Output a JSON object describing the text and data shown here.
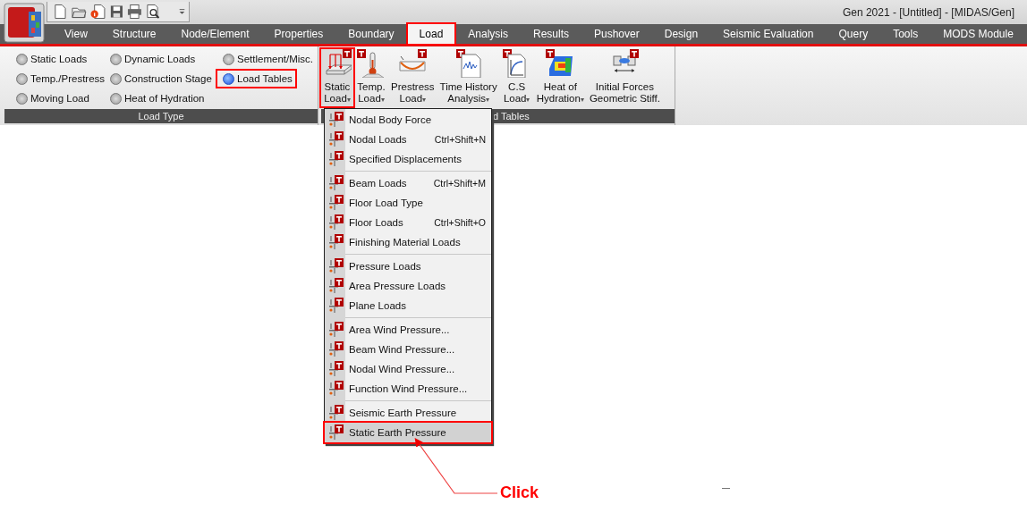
{
  "title_bar": {
    "title": "Gen 2021 - [Untitled] - [MIDAS/Gen]"
  },
  "tabs": [
    {
      "label": "View",
      "selected": false,
      "highlighted": false
    },
    {
      "label": "Structure",
      "selected": false,
      "highlighted": false
    },
    {
      "label": "Node/Element",
      "selected": false,
      "highlighted": false
    },
    {
      "label": "Properties",
      "selected": false,
      "highlighted": false
    },
    {
      "label": "Boundary",
      "selected": false,
      "highlighted": false
    },
    {
      "label": "Load",
      "selected": true,
      "highlighted": true
    },
    {
      "label": "Analysis",
      "selected": false,
      "highlighted": false
    },
    {
      "label": "Results",
      "selected": false,
      "highlighted": false
    },
    {
      "label": "Pushover",
      "selected": false,
      "highlighted": false
    },
    {
      "label": "Design",
      "selected": false,
      "highlighted": false
    },
    {
      "label": "Seismic Evaluation",
      "selected": false,
      "highlighted": false
    },
    {
      "label": "Query",
      "selected": false,
      "highlighted": false
    },
    {
      "label": "Tools",
      "selected": false,
      "highlighted": false
    },
    {
      "label": "MODS Module",
      "selected": false,
      "highlighted": false
    }
  ],
  "load_type": {
    "title": "Load Type",
    "options": [
      {
        "label": "Static Loads",
        "selected": false,
        "highlighted": false
      },
      {
        "label": "Temp./Prestress",
        "selected": false,
        "highlighted": false
      },
      {
        "label": "Moving Load",
        "selected": false,
        "highlighted": false
      },
      {
        "label": "Dynamic Loads",
        "selected": false,
        "highlighted": false
      },
      {
        "label": "Construction Stage",
        "selected": false,
        "highlighted": false
      },
      {
        "label": "Heat of Hydration",
        "selected": false,
        "highlighted": false
      },
      {
        "label": "Settlement/Misc.",
        "selected": false,
        "highlighted": false
      },
      {
        "label": "Load Tables",
        "selected": true,
        "highlighted": true
      }
    ]
  },
  "load_tables": {
    "title": "d Tables",
    "buttons": [
      {
        "kind": "static",
        "lines": [
          "Static",
          "Load"
        ],
        "caret": "▾",
        "highlighted": true
      },
      {
        "kind": "temp",
        "lines": [
          "Temp.",
          "Load"
        ],
        "caret": "▾",
        "highlighted": false
      },
      {
        "kind": "prestress",
        "lines": [
          "Prestress",
          "Load"
        ],
        "caret": "▾",
        "highlighted": false
      },
      {
        "kind": "history",
        "lines": [
          "Time History",
          "Analysis"
        ],
        "caret": "▾",
        "highlighted": false
      },
      {
        "kind": "cs",
        "lines": [
          "C.S",
          "Load"
        ],
        "caret": "▾",
        "highlighted": false
      },
      {
        "kind": "heat",
        "lines": [
          "Heat of",
          "Hydration"
        ],
        "caret": "▾",
        "highlighted": false
      },
      {
        "kind": "initial",
        "lines": [
          "Initial Forces",
          "Geometric Stiff."
        ],
        "highlighted": false
      }
    ]
  },
  "menu": {
    "sections": [
      [
        {
          "label": "Nodal Body Force",
          "highlighted": false
        },
        {
          "label": "Nodal Loads",
          "shortcut": "Ctrl+Shift+N",
          "highlighted": false
        },
        {
          "label": "Specified Displacements",
          "highlighted": false
        }
      ],
      [
        {
          "label": "Beam Loads",
          "shortcut": "Ctrl+Shift+M",
          "highlighted": false
        },
        {
          "label": "Floor Load Type",
          "highlighted": false
        },
        {
          "label": "Floor Loads",
          "shortcut": "Ctrl+Shift+O",
          "highlighted": false
        },
        {
          "label": "Finishing Material Loads",
          "highlighted": false
        }
      ],
      [
        {
          "label": "Pressure Loads",
          "highlighted": false
        },
        {
          "label": "Area Pressure Loads",
          "highlighted": false
        },
        {
          "label": "Plane Loads",
          "highlighted": false
        }
      ],
      [
        {
          "label": "Area Wind Pressure...",
          "highlighted": false
        },
        {
          "label": "Beam Wind Pressure...",
          "highlighted": false
        },
        {
          "label": "Nodal Wind Pressure...",
          "highlighted": false
        },
        {
          "label": "Function Wind Pressure...",
          "highlighted": false
        }
      ],
      [
        {
          "label": "Seismic Earth Pressure",
          "highlighted": false
        },
        {
          "label": "Static Earth Pressure",
          "highlighted": true
        }
      ]
    ]
  },
  "annotation": {
    "label": "Click"
  }
}
